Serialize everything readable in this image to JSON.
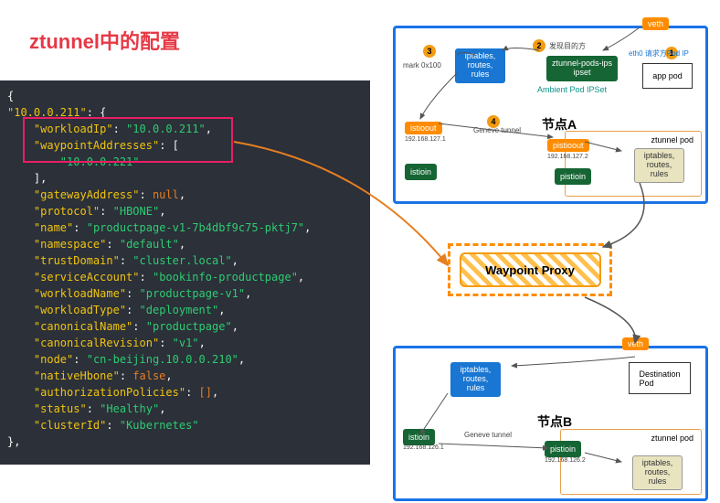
{
  "title": "ztunnel中的配置",
  "code": {
    "ip": "10.0.0.211",
    "workloadIp": "10.0.0.211",
    "waypointAddresses": "10.0.0.221",
    "gatewayAddress": "null",
    "protocol": "HBONE",
    "name": "productpage-v1-7b4dbf9c75-pktj7",
    "namespace": "default",
    "trustDomain": "cluster.local",
    "serviceAccount": "bookinfo-productpage",
    "workloadName": "productpage-v1",
    "workloadType": "deployment",
    "canonicalName": "productpage",
    "canonicalRevision": "v1",
    "node": "cn-beijing.10.0.0.210",
    "nativeHbone": "false",
    "authorizationPolicies": "[]",
    "status": "Healthy",
    "clusterId": "Kubernetes"
  },
  "diagram": {
    "nodeA": {
      "label": "节点A",
      "eth0": "eth0 请求方Pod IP",
      "mark": "mark 0x100",
      "find": "发现目的方",
      "ambient": "Ambient Pod IPSet",
      "ztunnelIps": "ztunnel-pods-ips\nipset",
      "iptables": "iptables,\nroutes,\nrules",
      "geneve": "Geneve tunnel",
      "appPod": "app pod",
      "ztunnelPod": "ztunnel pod",
      "istioout": "istioout",
      "istioin": "istioin",
      "pistioout": "pistioout",
      "pistioin": "pistioin",
      "ip1": "192.168.127.1",
      "ip2": "192.168.127.2"
    },
    "nodeB": {
      "label": "节点B",
      "geneve": "Geneve tunnel",
      "destPod": "Destination\nPod",
      "ztunnelPod": "ztunnel pod",
      "iptables": "iptables,\nroutes,\nrules",
      "istioin": "istioin",
      "pistioin": "pistioin",
      "ip1": "192.168.126.1",
      "ip2": "192.168.126.2"
    },
    "veth": "veth",
    "waypoint": "Waypoint Proxy"
  }
}
